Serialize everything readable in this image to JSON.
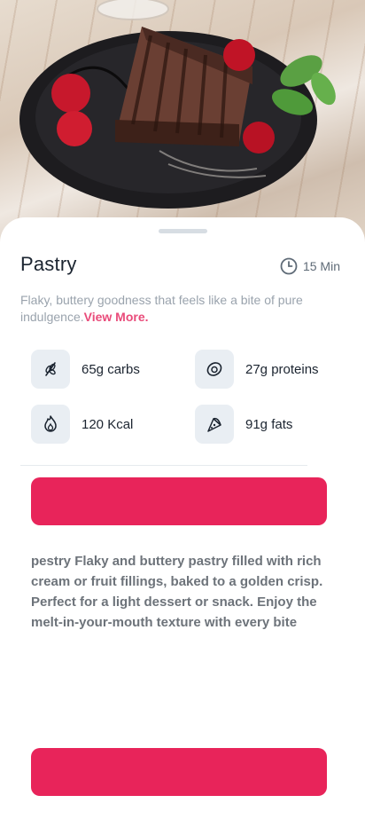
{
  "hero": {
    "alt": "chocolate-cake-slice-image"
  },
  "recipe": {
    "title": "Pastry",
    "time": "15 Min",
    "short_description": "Flaky, buttery goodness that feels like a bite of pure indulgence.",
    "view_more": "View More."
  },
  "nutrition": [
    {
      "icon": "wheat-icon",
      "label": "65g carbs"
    },
    {
      "icon": "avocado-icon",
      "label": "27g proteins"
    },
    {
      "icon": "flame-icon",
      "label": "120 Kcal"
    },
    {
      "icon": "pizza-slice-icon",
      "label": "91g fats"
    }
  ],
  "buttons": {
    "primary_label": "",
    "bottom_label": ""
  },
  "long_description": "pestry Flaky and buttery pastry filled with rich cream or fruit fillings, baked to a golden crisp. Perfect for a light dessert or snack. Enjoy the melt-in-your-mouth texture with every bite",
  "colors": {
    "accent": "#e8245a",
    "link": "#e94b7a",
    "icon_bg": "#e9eef3"
  }
}
